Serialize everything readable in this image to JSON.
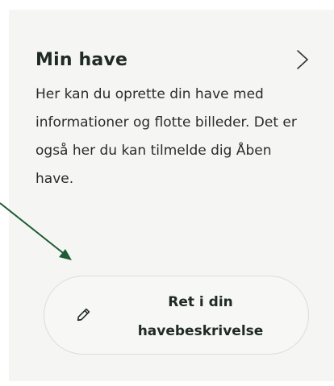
{
  "card": {
    "title": "Min have",
    "description": "Her kan du oprette din have med informationer og flotte billeder. Det er også her du kan tilmelde dig Åben have.",
    "button": {
      "label_line1": "Ret i din",
      "label_line2": "havebeskrivelse"
    }
  },
  "icons": {
    "header": "chevron-right-icon",
    "button": "pencil-edit-icon"
  },
  "colors": {
    "card_background": "#f5f5f3",
    "text": "#1f2a22",
    "arrow": "#1f5b35"
  }
}
